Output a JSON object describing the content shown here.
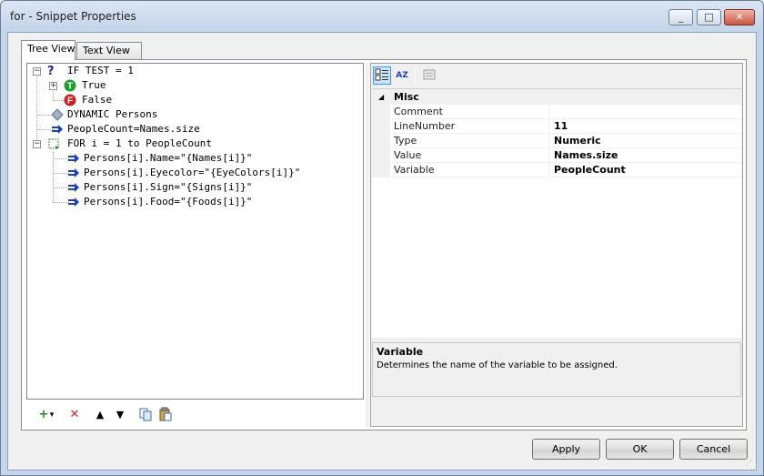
{
  "window": {
    "title": "for - Snippet Properties",
    "minimize_label": "_",
    "maximize_label": "□",
    "close_label": "✕"
  },
  "tabs": [
    {
      "label": "Tree View",
      "active": true
    },
    {
      "label": "Text View",
      "active": false
    }
  ],
  "tree": {
    "nodes": [
      {
        "label": "IF TEST = 1",
        "icon": "question-icon"
      },
      {
        "label": "True",
        "icon": "true-badge-icon"
      },
      {
        "label": "False",
        "icon": "false-badge-icon"
      },
      {
        "label": "DYNAMIC Persons",
        "icon": "dynamic-diamond-icon"
      },
      {
        "label": "PeopleCount=Names.size",
        "icon": "assign-arrow-icon"
      },
      {
        "label": "FOR i = 1 to PeopleCount",
        "icon": "for-loop-icon"
      },
      {
        "label": "Persons[i].Name=\"{Names[i]}\"",
        "icon": "assign-arrow-icon"
      },
      {
        "label": "Persons[i].Eyecolor=\"{EyeColors[i]}\"",
        "icon": "assign-arrow-icon"
      },
      {
        "label": "Persons[i].Sign=\"{Signs[i]}\"",
        "icon": "assign-arrow-icon"
      },
      {
        "label": "Persons[i].Food=\"{Foods[i]}\"",
        "icon": "assign-arrow-icon"
      }
    ],
    "badge_true": "T",
    "badge_false": "F",
    "question_mark": "?"
  },
  "tree_toolbar": {
    "add_glyph": "+",
    "dropdown_glyph": "▾",
    "delete_glyph": "✕",
    "up_glyph": "▲",
    "down_glyph": "▼"
  },
  "property_grid": {
    "sort_glyph": "AZ",
    "category": "Misc",
    "category_toggle": "◢",
    "rows": [
      {
        "name": "Comment",
        "value": ""
      },
      {
        "name": "LineNumber",
        "value": "11"
      },
      {
        "name": "Type",
        "value": "Numeric"
      },
      {
        "name": "Value",
        "value": "Names.size"
      },
      {
        "name": "Variable",
        "value": "PeopleCount"
      }
    ],
    "help_title": "Variable",
    "help_text": "Determines the name of the variable to be assigned."
  },
  "buttons": {
    "apply": "Apply",
    "ok": "OK",
    "cancel": "Cancel"
  },
  "colors": {
    "true_badge": "#1e9e2e",
    "false_badge": "#d41f1f",
    "assign_arrow": "#1b3fc4",
    "question": "#3a1a9a"
  }
}
